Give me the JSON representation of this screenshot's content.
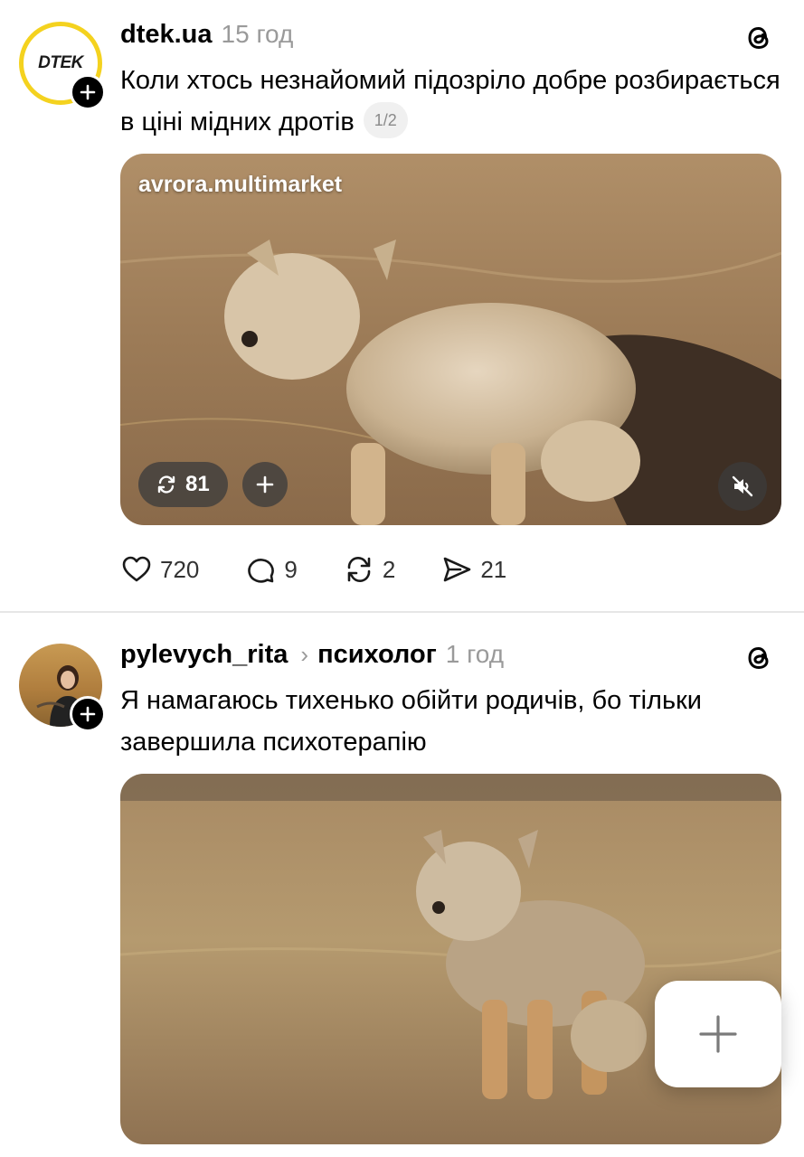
{
  "posts": [
    {
      "username": "dtek.ua",
      "time": "15 год",
      "avatar_logo_text": "DTEK",
      "text": "Коли хтось незнайомий підозріло добре розбирається в ціні мідних дротів",
      "page_indicator": "1/2",
      "media": {
        "watermark": "avrora.multimarket",
        "repost_count": "81",
        "muted": true
      },
      "actions": {
        "likes": "720",
        "comments": "9",
        "reposts": "2",
        "shares": "21"
      }
    },
    {
      "username": "pylevych_rita",
      "topic": "психолог",
      "time": "1 год",
      "text": "Я намагаюсь тихенько обійти родичів, бо тільки завершила психотерапію"
    }
  ],
  "icons": {
    "threads": "threads-logo-icon",
    "follow": "plus-icon",
    "like": "heart-icon",
    "comment": "comment-bubble-icon",
    "repost": "repost-icon",
    "share": "send-icon",
    "mute": "speaker-muted-icon",
    "fab": "plus-icon"
  },
  "colors": {
    "avatar_ring": "#f4d21f",
    "muted_text": "#9a9a9a"
  }
}
